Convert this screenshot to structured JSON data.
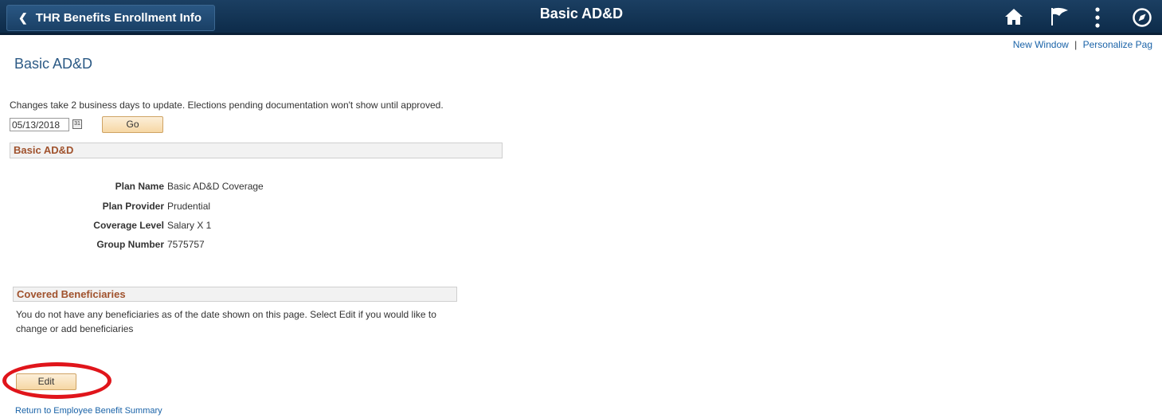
{
  "header": {
    "back_label": "THR Benefits Enrollment Info",
    "page_heading": "Basic AD&D",
    "icons": [
      "home-icon",
      "flag-icon",
      "more-vertical-icon",
      "navigator-icon"
    ]
  },
  "toplinks": {
    "new_window": "New Window",
    "separator": "|",
    "personalize": "Personalize Pag"
  },
  "page_title": "Basic AD&D",
  "info_text": "Changes take 2 business days to update. Elections pending documentation won't show until approved.",
  "date_filter": {
    "value": "05/13/2018",
    "calendar_glyph": "31",
    "go_label": "Go"
  },
  "plan_section": {
    "title": "Basic AD&D",
    "fields": [
      {
        "label": "Plan Name",
        "value": "Basic AD&D Coverage"
      },
      {
        "label": "Plan Provider",
        "value": "Prudential"
      },
      {
        "label": "Coverage Level",
        "value": "Salary X 1"
      },
      {
        "label": "Group Number",
        "value": "7575757"
      }
    ]
  },
  "beneficiaries_section": {
    "title": "Covered Beneficiaries",
    "message": "You do not have any beneficiaries as of the date shown on this page.  Select Edit if you would like to change or add beneficiaries"
  },
  "edit_label": "Edit",
  "return_link": "Return to Employee Benefit Summary",
  "colors": {
    "header_bg": "#0c2a48",
    "section_title": "#a0522d",
    "link": "#1a63a8",
    "button_bg": "#f6d7a4",
    "highlight_ring": "#e0151b"
  }
}
